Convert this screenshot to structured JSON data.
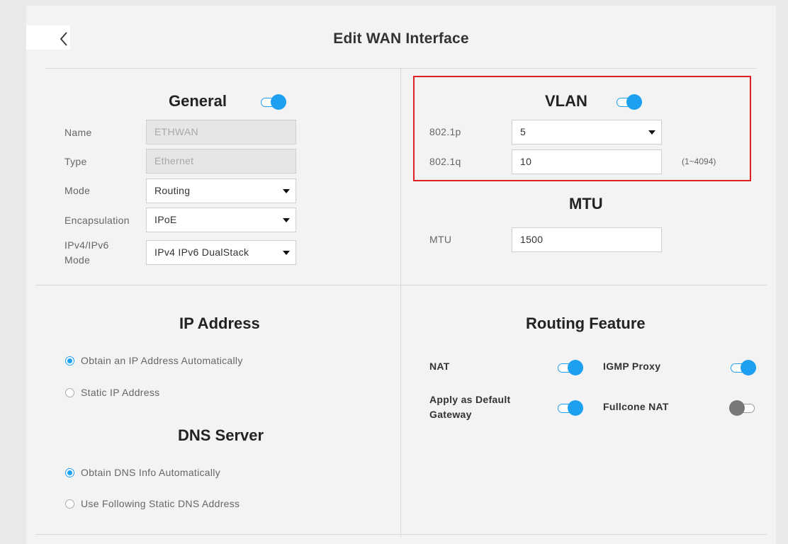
{
  "page": {
    "title": "Edit WAN Interface"
  },
  "general": {
    "title": "General",
    "enabled": true,
    "name_label": "Name",
    "name_value": "ETHWAN",
    "type_label": "Type",
    "type_value": "Ethernet",
    "mode_label": "Mode",
    "mode_value": "Routing",
    "encap_label": "Encapsulation",
    "encap_value": "IPoE",
    "ipmode_label_line1": "IPv4/IPv6",
    "ipmode_label_line2": "Mode",
    "ipmode_value": "IPv4 IPv6 DualStack"
  },
  "vlan": {
    "title": "VLAN",
    "enabled": true,
    "p_label": "802.1p",
    "p_value": "5",
    "q_label": "802.1q",
    "q_value": "10",
    "q_hint": "(1~4094)"
  },
  "mtu": {
    "title": "MTU",
    "label": "MTU",
    "value": "1500"
  },
  "ip_address": {
    "title": "IP Address",
    "options": [
      {
        "label": "Obtain an IP Address Automatically",
        "checked": true
      },
      {
        "label": "Static IP Address",
        "checked": false
      }
    ]
  },
  "dns_server": {
    "title": "DNS Server",
    "options": [
      {
        "label": "Obtain DNS Info Automatically",
        "checked": true
      },
      {
        "label": "Use Following Static DNS Address",
        "checked": false
      }
    ]
  },
  "routing_feature": {
    "title": "Routing Feature",
    "nat_label": "NAT",
    "nat_on": true,
    "default_gw_label_line1": "Apply as Default",
    "default_gw_label_line2": "Gateway",
    "default_gw_on": true,
    "igmp_label": "IGMP Proxy",
    "igmp_on": true,
    "fullcone_label": "Fullcone NAT",
    "fullcone_on": false
  },
  "colors": {
    "accent": "#1ea0f0",
    "highlight_border": "#e02020"
  },
  "icons": {
    "back": "chevron-left-icon"
  }
}
